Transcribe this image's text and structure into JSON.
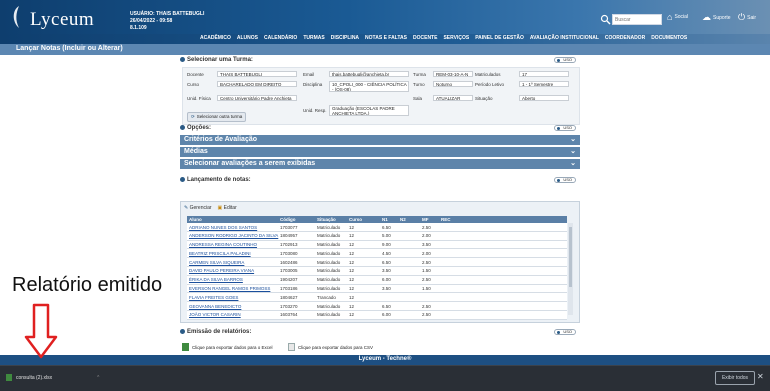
{
  "header": {
    "logo_text": "Lyceum",
    "user_label": "USUÁRIO: THAIS BATTEBUGLI",
    "datetime": "26/04/2022 - 09:58",
    "version": "8.1.109",
    "search_placeholder": "Buscar",
    "actions": [
      "Social",
      "Suporte",
      "Sair"
    ]
  },
  "menu": [
    "ACADÊMICO",
    "ALUNOS",
    "CALENDÁRIO",
    "TURMAS",
    "DISCIPLINA",
    "NOTAS E FALTAS",
    "DOCENTE",
    "SERVIÇOS",
    "PAINEL DE GESTÃO",
    "AVALIAÇÃO INSTITUCIONAL",
    "COORDENADOR",
    "DOCUMENTOS"
  ],
  "page_title": "Lançar Notas (Incluir ou Alterar)",
  "sections": {
    "select_turma": "Selecionar uma Turma:",
    "opcoes": "Opções:",
    "criterios": "Critérios de Avaliação",
    "medias": "Médias",
    "selecionar_avaliacoes": "Selecionar avaliações a serem exibidas",
    "lancamento": "Lançamento de notas:",
    "emissao": "Emissão de relatórios:",
    "uso_label": "USO"
  },
  "turma": {
    "docente_label": "Docente",
    "docente": "THAIS BATTEBUGLI",
    "email_label": "Email",
    "email": "thais.battebugli@anchieta.br",
    "turma_label": "Turma",
    "turma": "REM-03-10-A-N",
    "matriculados_label": "Matriculados",
    "matriculados": "17",
    "curso_label": "Curso",
    "curso": "BACHARELADO EM DIREITO",
    "disciplina_label": "Disciplina",
    "disciplina": "10_CPOLI_000 - CIÊNCIA POLÍTICA - (OS-08)",
    "turno_label": "Turno",
    "turno": "Noturno",
    "periodo_label": "Período Letivo",
    "periodo": "1 - 1º Semestre",
    "unid_label": "Unid. Física",
    "unid": "Centro Universitário Padre Anchieta",
    "sala_label": "Sala",
    "sala": "ATUALIZAR",
    "situacao_label": "Situação",
    "situacao": "Aberto",
    "resp_label": "Unid. Resp.",
    "resp": "Graduação (ESCOLAS PADRE ANCHIETA LTDA.)",
    "select_button": "Selecionar outra turma"
  },
  "table": {
    "toolbar": [
      "Gerenciar",
      "Editar"
    ],
    "columns": [
      "Aluno",
      "Código",
      "Situação",
      "Curso",
      "N1",
      "N2",
      "MF",
      "REC"
    ],
    "rows": [
      [
        "ADRIANO NUNES DOS SANTOS",
        "1703077",
        "Matriculado",
        "12",
        "6.50",
        "2.50"
      ],
      [
        "ANDERSON RODRIGO JACINTO DA SILVA",
        "1804957",
        "Matriculado",
        "12",
        "5.00",
        "2.00"
      ],
      [
        "ANDRESSA REGINA COUTINHO",
        "1702913",
        "Matriculado",
        "12",
        "9.00",
        "3.50"
      ],
      [
        "BEATRIZ PRISCILA PALADINI",
        "1703080",
        "Matriculado",
        "12",
        "4.50",
        "2.00"
      ],
      [
        "CARMEN SILVA SIQUEIRA",
        "1602486",
        "Matriculado",
        "12",
        "6.50",
        "2.50"
      ],
      [
        "DAVID PAULO PEREIRA VIANA",
        "1703005",
        "Matriculado",
        "12",
        "3.50",
        "1.50"
      ],
      [
        "ÉRIKA DA SILVA BARROS",
        "1904207",
        "Matriculado",
        "12",
        "6.00",
        "2.50"
      ],
      [
        "EVERSON RANGEL RAMOS PRIMOSS",
        "1703186",
        "Matriculado",
        "12",
        "3.50",
        "1.50"
      ],
      [
        "FLAVIA FREITES GOES",
        "1804627",
        "Trancado",
        "12",
        "",
        ""
      ],
      [
        "GEOVANNA BENEDICTO",
        "1703270",
        "Matriculado",
        "12",
        "6.50",
        "2.50"
      ],
      [
        "JOÃO VICTOR CASARIN",
        "1603764",
        "Matriculado",
        "12",
        "6.00",
        "2.50"
      ]
    ]
  },
  "exports": {
    "excel": "Clique para exportar dados para o Excel",
    "csv": "Clique para exportar dados para CSV"
  },
  "footer": "Lyceum - Techne®",
  "download": {
    "filename": "consulta (2).xlsx",
    "show_all": "Exibir todos"
  },
  "annotation": "Relatório emitido",
  "colors": {
    "header": "#1a5a94",
    "titlebar": "#5c87b2",
    "sectionbar": "#5e85ab",
    "arrow": "#e02020"
  }
}
